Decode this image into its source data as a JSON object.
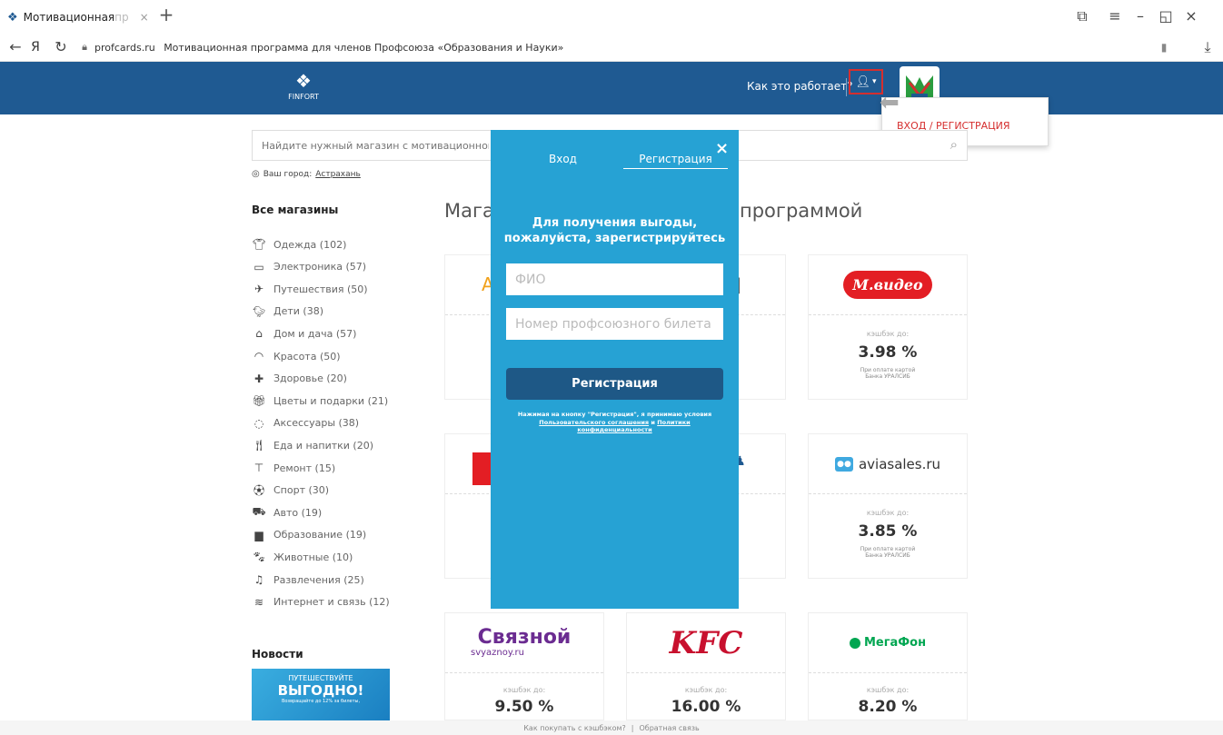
{
  "browser": {
    "tab_title": "Мотивационная",
    "tab_title_fade": "пр",
    "tab_close": "×",
    "new_tab": "+",
    "yandex": "Я",
    "domain": "profcards.ru",
    "page_title": "Мотивационная программа для членов Профсоюза «Образования и Науки»"
  },
  "header": {
    "logo_text": "FINFORT",
    "how_it_works": "Как это работает?",
    "login_tooltip": "ВХОД / РЕГИСТРАЦИЯ"
  },
  "search": {
    "placeholder": "Найдите нужный магазин с мотивационной"
  },
  "city": {
    "label": "Ваш город:",
    "value": "Астрахань"
  },
  "sidebar": {
    "title": "Все магазины",
    "categories": [
      {
        "label": "Одежда (102)",
        "icon": "shirt-icon"
      },
      {
        "label": "Электроника (57)",
        "icon": "monitor-icon"
      },
      {
        "label": "Путешествия (50)",
        "icon": "plane-icon"
      },
      {
        "label": "Дети (38)",
        "icon": "duck-icon"
      },
      {
        "label": "Дом и дача (57)",
        "icon": "house-icon"
      },
      {
        "label": "Красота (50)",
        "icon": "lips-icon"
      },
      {
        "label": "Здоровье (20)",
        "icon": "medkit-icon"
      },
      {
        "label": "Цветы и подарки (21)",
        "icon": "gift-icon"
      },
      {
        "label": "Аксессуары (38)",
        "icon": "ring-icon"
      },
      {
        "label": "Еда и напитки (20)",
        "icon": "food-icon"
      },
      {
        "label": "Ремонт (15)",
        "icon": "roller-icon"
      },
      {
        "label": "Спорт (30)",
        "icon": "sport-icon"
      },
      {
        "label": "Авто (19)",
        "icon": "car-icon"
      },
      {
        "label": "Образование (19)",
        "icon": "book-icon"
      },
      {
        "label": "Животные (10)",
        "icon": "paw-icon"
      },
      {
        "label": "Развлечения (25)",
        "icon": "music-icon"
      },
      {
        "label": "Интернет и связь (12)",
        "icon": "wifi-icon"
      }
    ],
    "news_title": "Новости",
    "news_banner_line1": "ПУТЕШЕСТВУЙТЕ",
    "news_banner_line2": "ВЫГОДНО!",
    "news_banner_line3": "Возвращайте до 12% за билеты,"
  },
  "main": {
    "heading_left": "Мага",
    "heading_right": "программой",
    "cashback_label": "кэшбэк до:",
    "card_note_line1": "При оплате картой",
    "card_note_line2": "Банка УРАЛСИБ",
    "mvideo": {
      "logo": "М.видео",
      "rate": "3.98 %"
    },
    "aviasales": {
      "logo": "aviasales.ru",
      "rate": "3.85 %"
    },
    "svyaznoy": {
      "logo": "Связной",
      "sub": "svyaznoy.ru",
      "rate": "9.50 %"
    },
    "kfc": {
      "logo": "KFC",
      "rate": "16.00 %"
    },
    "megafon": {
      "logo": "МегаФон",
      "rate": "8.20 %"
    }
  },
  "modal": {
    "tab_login": "Вход",
    "tab_register": "Регистрация",
    "close": "×",
    "heading_line1": "Для получения выгоды,",
    "heading_line2": "пожалуйста, зарегистрируйтесь",
    "fio_placeholder": "ФИО",
    "ticket_placeholder": "Номер профсоюзного билета",
    "submit": "Регистрация",
    "terms_prefix": "Нажимая на кнопку \"Регистрация\", я принимаю условия",
    "terms_link1": "Пользовательского соглашения",
    "terms_and": "и",
    "terms_link2": "Политики конфиденциальности"
  },
  "footer": {
    "link1": "Как покупать с кэшбэком?",
    "sep": "|",
    "link2": "Обратная связь"
  },
  "colors": {
    "header_bg": "#1f5a92",
    "modal_bg": "#26a2d4",
    "modal_button": "#1e5886",
    "tooltip_text": "#d52f2f"
  }
}
